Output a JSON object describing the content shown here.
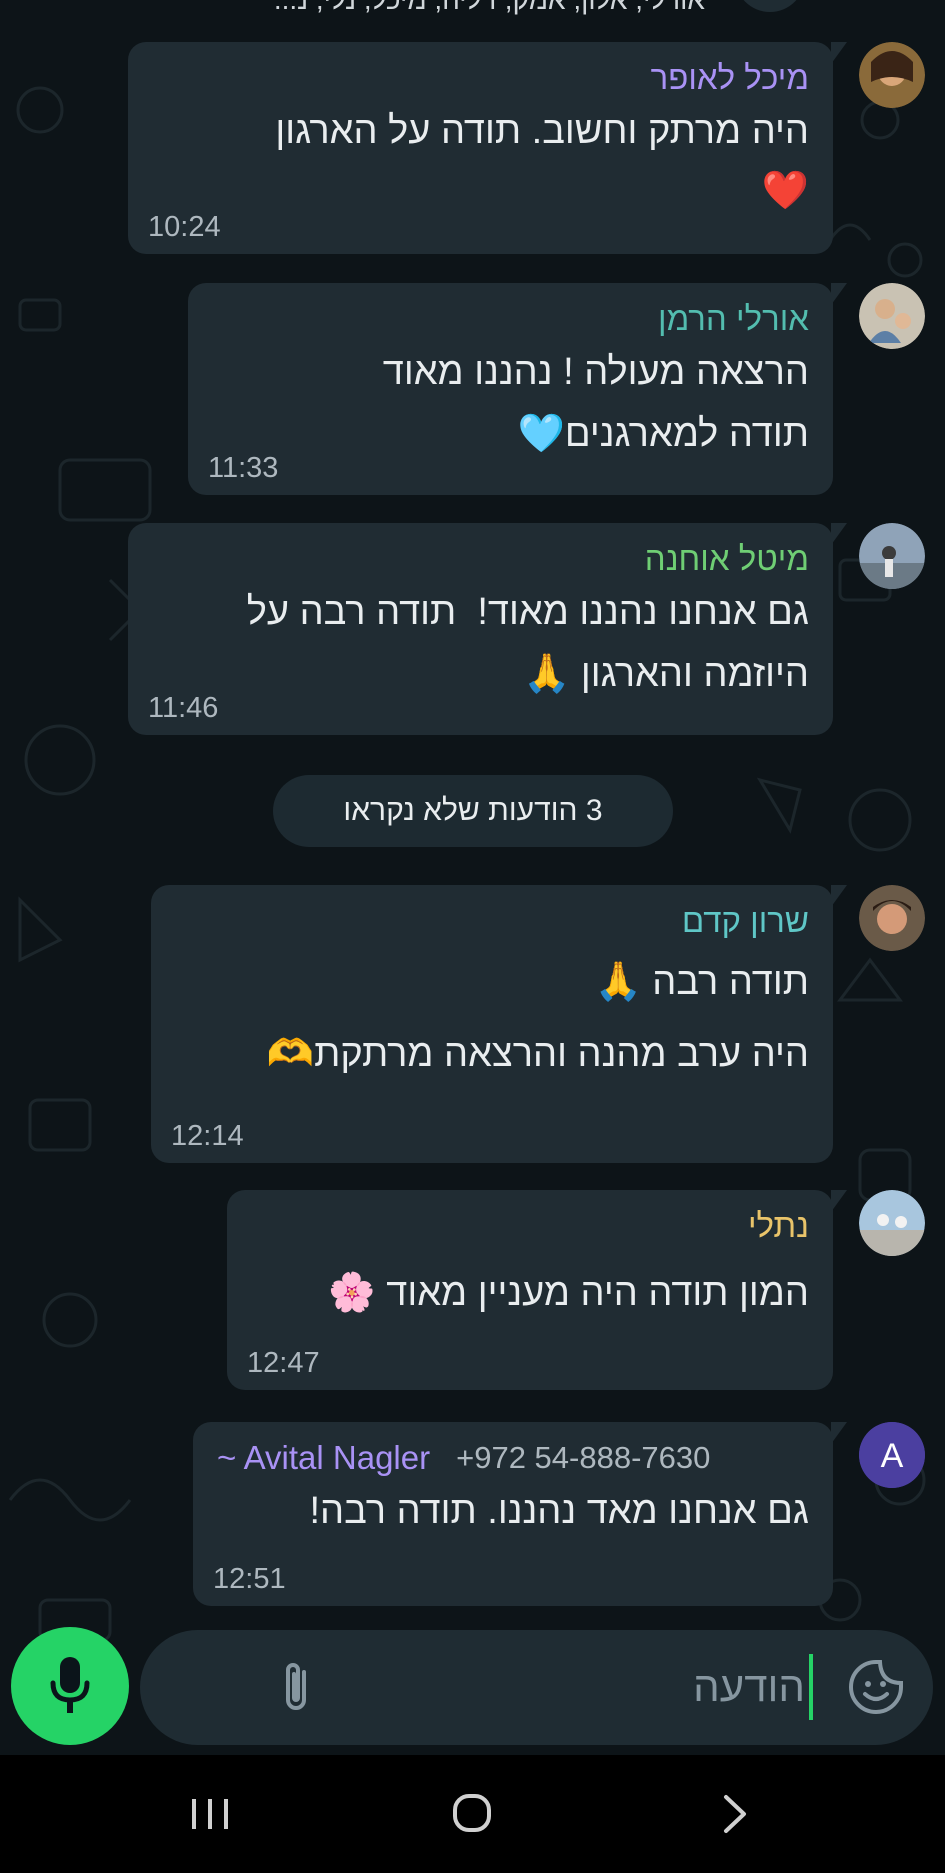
{
  "header": {
    "participants": "אורלי, אלון, אמק, דליה, מיכל, נלי, נ..."
  },
  "messages": [
    {
      "sender": "מיכל לאופר",
      "sender_color": "#a992f5",
      "lines": [
        "היה מרתק וחשוב. תודה על הארגון",
        "❤️"
      ],
      "time": "10:24"
    },
    {
      "sender": "אורלי הרמן",
      "sender_color": "#53bdaf",
      "lines": [
        "הרצאה מעולה ! נהננו מאוד",
        "תודה למארגנים🩵"
      ],
      "time": "11:33"
    },
    {
      "sender": "מיטל אוחנה",
      "sender_color": "#6fce74",
      "lines": [
        "גם אנחנו נהננו מאוד!  תודה רבה על",
        "היוזמה והארגון 🙏"
      ],
      "time": "11:46"
    },
    {
      "sender": "שרון קדם",
      "sender_color": "#5fc7c7",
      "lines": [
        "תודה רבה 🙏",
        "היה ערב מהנה והרצאה מרתקת🫶"
      ],
      "time": "12:14"
    },
    {
      "sender": "נתלי",
      "sender_color": "#e9c46a",
      "lines": [
        "המון תודה היה מעניין מאוד 🌸"
      ],
      "time": "12:47"
    },
    {
      "sender": "~ Avital Nagler",
      "sender_color": "#a992f5",
      "phone": "+972 54-888-7630",
      "lines": [
        "גם אנחנו מאד נהננו. תודה רבה!"
      ],
      "time": "12:51",
      "avatar_letter": "A"
    }
  ],
  "unread_label": "3 הודעות שלא נקראו",
  "composer": {
    "placeholder": "הודעה"
  },
  "colors": {
    "background": "#0b141a",
    "bubble": "#202c33",
    "accent": "#25d366",
    "avatar_letter_bg": "#4b3fa0"
  },
  "icons": {
    "mic": "mic-icon",
    "attach": "paperclip-icon",
    "sticker": "sticker-icon",
    "nav_recents": "recents-icon",
    "nav_home": "home-icon",
    "nav_back": "back-icon"
  }
}
